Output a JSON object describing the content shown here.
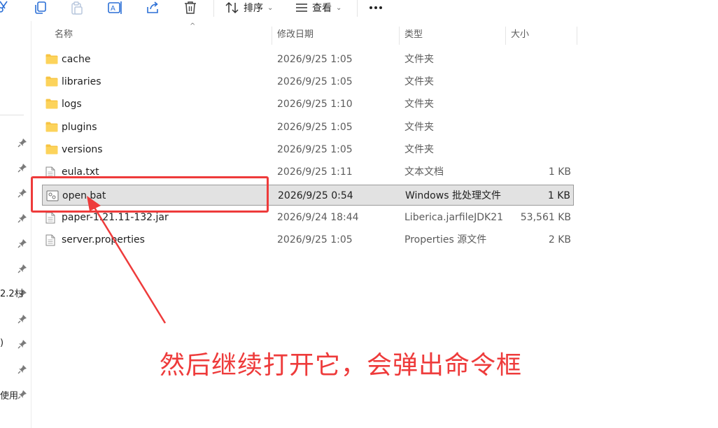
{
  "toolbar": {
    "sort_label": "排序",
    "view_label": "查看",
    "more_label": "···"
  },
  "sidebar": {
    "fragments": [
      "2.2村",
      ")",
      "使用"
    ]
  },
  "header": {
    "name": "名称",
    "date": "修改日期",
    "type": "类型",
    "size": "大小"
  },
  "files": [
    {
      "name": "cache",
      "date": "2026/9/25 1:05",
      "type": "文件夹",
      "size": "",
      "icon": "folder-icon"
    },
    {
      "name": "libraries",
      "date": "2026/9/25 1:05",
      "type": "文件夹",
      "size": "",
      "icon": "folder-icon"
    },
    {
      "name": "logs",
      "date": "2026/9/25 1:10",
      "type": "文件夹",
      "size": "",
      "icon": "folder-icon"
    },
    {
      "name": "plugins",
      "date": "2026/9/25 1:05",
      "type": "文件夹",
      "size": "",
      "icon": "folder-icon"
    },
    {
      "name": "versions",
      "date": "2026/9/25 1:05",
      "type": "文件夹",
      "size": "",
      "icon": "folder-icon"
    },
    {
      "name": "eula.txt",
      "date": "2026/9/25 1:11",
      "type": "文本文档",
      "size": "1 KB",
      "icon": "text-file-icon"
    },
    {
      "name": "open.bat",
      "date": "2026/9/25 0:54",
      "type": "Windows 批处理文件",
      "size": "1 KB",
      "icon": "batch-file-icon",
      "selected": true
    },
    {
      "name": "paper-1.21.11-132.jar",
      "date": "2026/9/24 18:44",
      "type": "Liberica.jarfileJDK21",
      "size": "53,561 KB",
      "icon": "jar-file-icon"
    },
    {
      "name": "server.properties",
      "date": "2026/9/25 1:05",
      "type": "Properties 源文件",
      "size": "2 KB",
      "icon": "text-file-icon"
    }
  ],
  "annotation": {
    "text": "然后继续打开它，会弹出命令框",
    "color": "#ee3b3b"
  },
  "colors": {
    "folder": "#f7c443",
    "selection": "#e2e2e2",
    "accent_red": "#ee3b3b"
  }
}
